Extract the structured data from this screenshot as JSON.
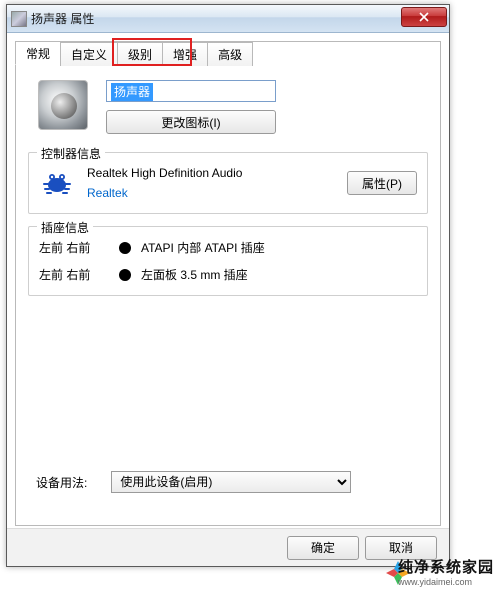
{
  "window": {
    "title": "扬声器 属性"
  },
  "tabs": [
    "常规",
    "自定义",
    "级别",
    "增强",
    "高级"
  ],
  "general": {
    "name_value": "扬声器",
    "change_icon_btn": "更改图标(I)"
  },
  "controller": {
    "legend": "控制器信息",
    "device": "Realtek High Definition Audio",
    "maker": "Realtek",
    "properties_btn": "属性(P)"
  },
  "jack": {
    "legend": "插座信息",
    "rows": [
      {
        "pos": "左前 右前",
        "desc": "ATAPI 内部 ATAPI 插座"
      },
      {
        "pos": "左前 右前",
        "desc": "左面板 3.5 mm 插座"
      }
    ]
  },
  "usage": {
    "label": "设备用法:",
    "selected": "使用此设备(启用)"
  },
  "footer": {
    "ok": "确定",
    "cancel": "取消"
  },
  "watermark": {
    "main": "纯净系统家园",
    "sub": "www.yidaimei.com"
  }
}
